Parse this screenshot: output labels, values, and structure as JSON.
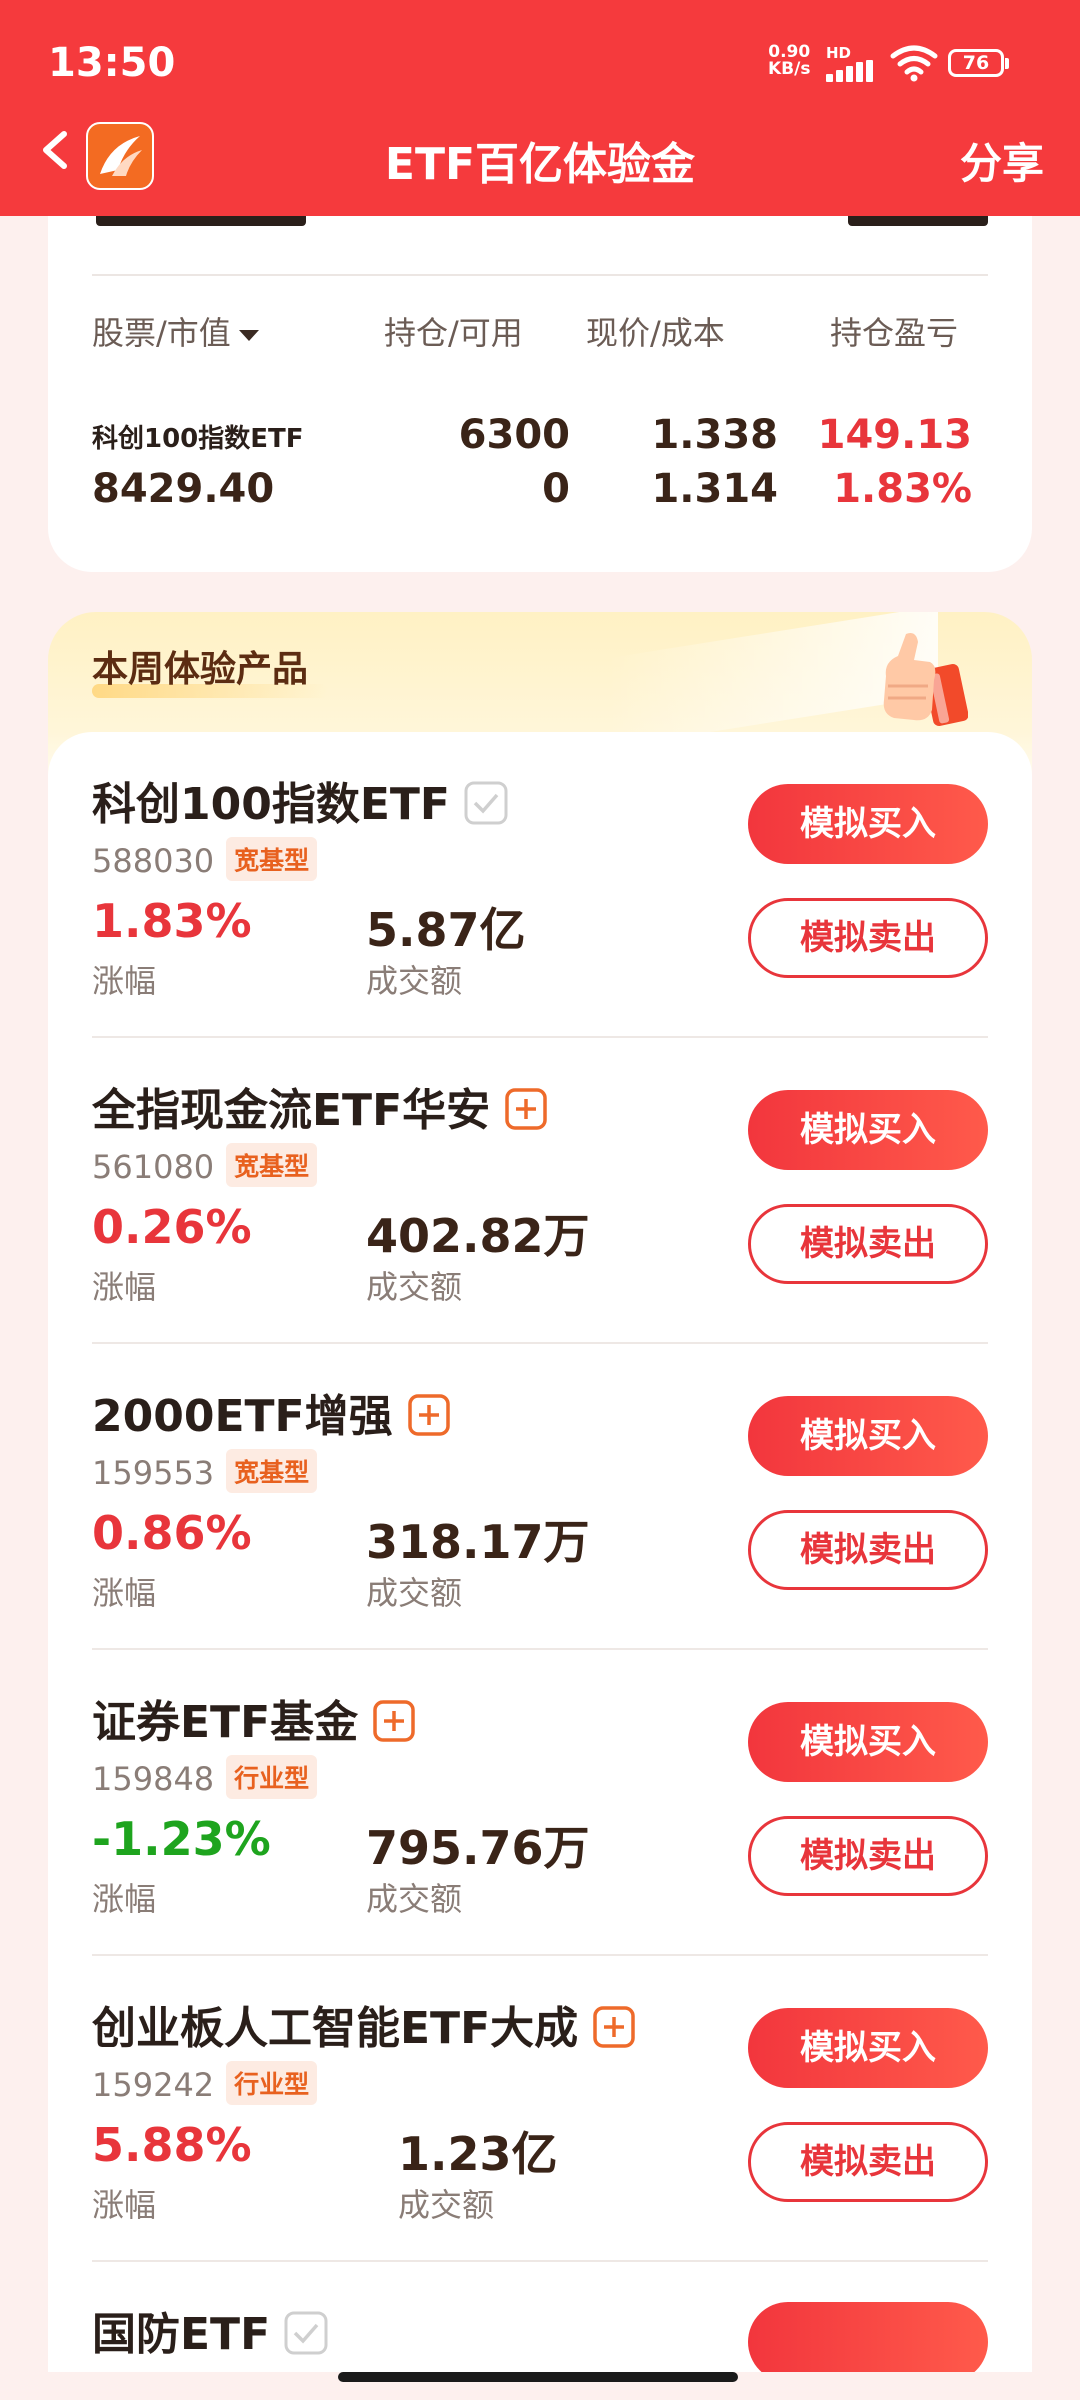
{
  "status": {
    "time": "13:50",
    "net_top": "0.90",
    "net_bottom": "KB/s",
    "hd": "HD",
    "battery": "76"
  },
  "header": {
    "title": "ETF百亿体验金",
    "share": "分享"
  },
  "holdings": {
    "headers": {
      "stock": "股票/市值",
      "position": "持仓/可用",
      "price": "现价/成本",
      "pnl": "持仓盈亏"
    },
    "row": {
      "name": "科创100指数ETF",
      "market_value": "8429.40",
      "position": "6300",
      "available": "0",
      "price": "1.338",
      "cost": "1.314",
      "pnl": "149.13",
      "pnl_pct": "1.83%"
    }
  },
  "section": {
    "title": "本周体验产品"
  },
  "labels": {
    "change": "涨幅",
    "turnover": "成交额",
    "buy": "模拟买入",
    "sell": "模拟卖出"
  },
  "products": [
    {
      "name": "科创100指数ETF",
      "mark": "check-icon",
      "code": "588030",
      "type": "宽基型",
      "change": "1.83%",
      "turnover": "5.87亿",
      "direction": "up"
    },
    {
      "name": "全指现金流ETF华安",
      "mark": "plus-icon",
      "code": "561080",
      "type": "宽基型",
      "change": "0.26%",
      "turnover": "402.82万",
      "direction": "up"
    },
    {
      "name": "2000ETF增强",
      "mark": "plus-icon",
      "code": "159553",
      "type": "宽基型",
      "change": "0.86%",
      "turnover": "318.17万",
      "direction": "up"
    },
    {
      "name": "证券ETF基金",
      "mark": "plus-icon",
      "code": "159848",
      "type": "行业型",
      "change": "-1.23%",
      "turnover": "795.76万",
      "direction": "down"
    },
    {
      "name": "创业板人工智能ETF大成",
      "mark": "plus-icon",
      "code": "159242",
      "type": "行业型",
      "change": "5.88%",
      "turnover": "1.23亿",
      "direction": "up"
    },
    {
      "name": "国防ETF",
      "mark": "check-icon"
    }
  ],
  "colors": {
    "brand_red": "#f53a3d",
    "up": "#e8353b",
    "down": "#1ea41e",
    "tag_orange": "#e8611f"
  }
}
